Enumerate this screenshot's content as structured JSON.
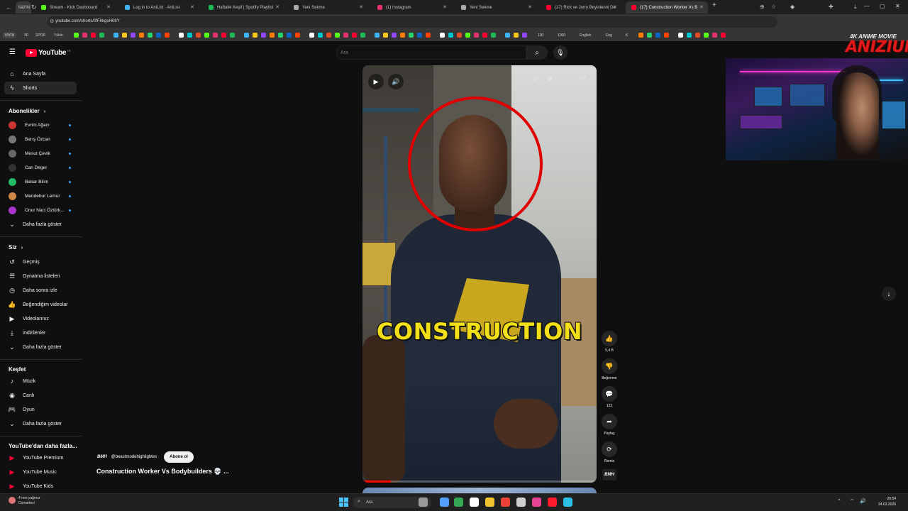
{
  "browser": {
    "tabs": [
      {
        "label": "YAYIN",
        "color": "#888888"
      },
      {
        "label": "Stream - Kick Dashboard",
        "color": "#53fc18"
      },
      {
        "label": "Log in to AniList · AniList",
        "color": "#3db4f2"
      },
      {
        "label": "Haftalık Keşif | Spotify Playlist",
        "color": "#1db954"
      },
      {
        "label": "Yeni Sekme",
        "color": "#aaaaaa"
      },
      {
        "label": "(1) Instagram",
        "color": "#e1306c"
      },
      {
        "label": "Yeni Sekme",
        "color": "#aaaaaa"
      },
      {
        "label": "(17) Rick ve Jerry Beyinlerini De",
        "color": "#ff0033"
      },
      {
        "label": "(17) Construction Worker Vs B",
        "color": "#ff0033"
      }
    ],
    "new_tab": "+",
    "url": "youtube.com/shorts/0fFhkgoH08Y",
    "bookmarks": [
      "YAYIN",
      "3D",
      "SPOR",
      "Yükle",
      "100",
      "1000",
      "English",
      "Eng",
      "K"
    ]
  },
  "youtube": {
    "logo_text": "YouTube",
    "logo_country": "TR",
    "search_placeholder": "Ara",
    "sidebar": {
      "main": [
        {
          "label": "Ana Sayfa",
          "icon": "home-icon",
          "glyph": "⌂"
        },
        {
          "label": "Shorts",
          "icon": "shorts-icon",
          "glyph": "⚡"
        }
      ],
      "subs_header": "Abonelikler",
      "subs": [
        {
          "label": "Evrim Ağacı",
          "color": "#c33"
        },
        {
          "label": "Barış Özcan",
          "color": "#777"
        },
        {
          "label": "Mesut Çevik",
          "color": "#666"
        },
        {
          "label": "Can Deger",
          "color": "#333"
        },
        {
          "label": "Bebar Bilim",
          "color": "#2b6"
        },
        {
          "label": "Mendebur Lemur",
          "color": "#c84"
        },
        {
          "label": "Onur Naci Öztürk...",
          "color": "#a3c"
        }
      ],
      "subs_more": "Daha fazla göster",
      "you_header": "Siz",
      "you": [
        {
          "label": "Geçmiş",
          "glyph": "↺"
        },
        {
          "label": "Oynatma listeleri",
          "glyph": "☰"
        },
        {
          "label": "Daha sonra izle",
          "glyph": "◷"
        },
        {
          "label": "Beğendiğim videolar",
          "glyph": "👍"
        },
        {
          "label": "Videolarınız",
          "glyph": "▶"
        },
        {
          "label": "İndirilenler",
          "glyph": "⤓"
        }
      ],
      "you_more": "Daha fazla göster",
      "explore_header": "Keşfet",
      "explore": [
        {
          "label": "Müzik",
          "glyph": "♪"
        },
        {
          "label": "Canlı",
          "glyph": "◉"
        },
        {
          "label": "Oyun",
          "glyph": "🎮"
        }
      ],
      "explore_more": "Daha fazla göster",
      "more_header": "YouTube'dan daha fazla...",
      "more": [
        {
          "label": "YouTube Premium"
        },
        {
          "label": "YouTube Music"
        },
        {
          "label": "YouTube Kids"
        }
      ]
    },
    "short": {
      "overlay_text": "CONSTRUCTION",
      "channel_handle": "@beastmodehighlightes",
      "channel_logo": "BMH",
      "subscribe_label": "Abone ol",
      "title": "Construction Worker Vs Bodybuilders 💀 ...",
      "progress": 0.12,
      "actions": {
        "like_count": "5,4 B",
        "dislike_label": "Beğenme",
        "comment_count": "122",
        "share_label": "Paylaş",
        "remix_label": "Remix"
      }
    }
  },
  "stream_overlay": {
    "brand_subtitle": "4K ANIME MOVIE",
    "brand_name": "ANIZIUM"
  },
  "taskbar": {
    "weather_line1": "4 mm yağmur",
    "weather_line2": "Cumartesi",
    "search_label": "Ara",
    "time": "20:54",
    "date": "24.03.2026"
  }
}
